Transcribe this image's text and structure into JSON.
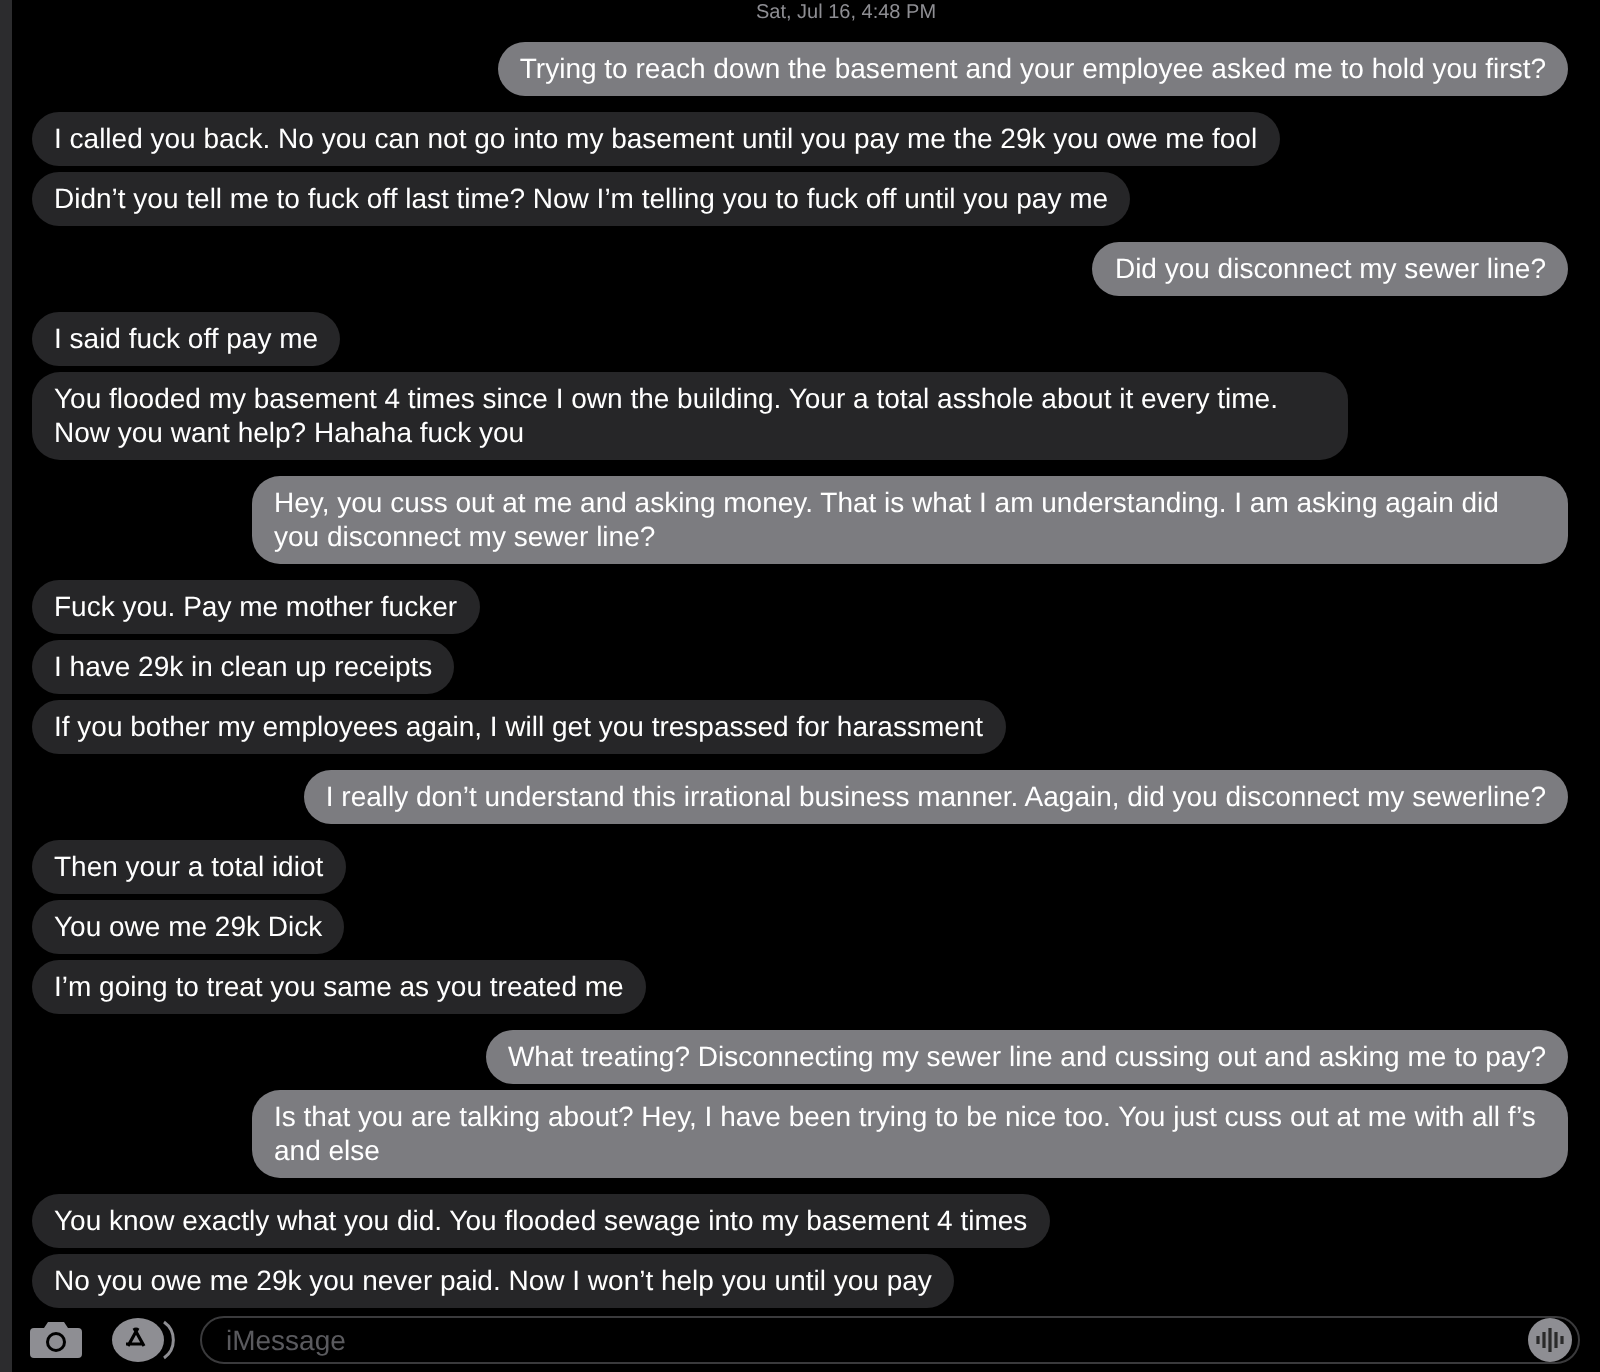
{
  "timestamp": "Sat, Jul 16, 4:48 PM",
  "messages": [
    {
      "kind": "sent",
      "text": "Trying to reach down the basement and your employee asked me to hold you first?"
    },
    {
      "kind": "received",
      "text": "I called you back. No you can not go into my basement until you pay me the 29k you owe me fool"
    },
    {
      "kind": "received",
      "text": "Didn’t you tell me to fuck off last time? Now I’m telling you to fuck off until you pay me"
    },
    {
      "kind": "sent",
      "text": "Did you disconnect my sewer line?"
    },
    {
      "kind": "received",
      "text": "I said fuck off pay me"
    },
    {
      "kind": "received",
      "text": "You flooded my basement 4 times since I own the building. Your a total asshole about it every time. Now you want help? Hahaha fuck you"
    },
    {
      "kind": "sent",
      "text": "Hey, you cuss out at me and asking money. That is what I am understanding. I am asking again did you disconnect my sewer line?"
    },
    {
      "kind": "received",
      "text": "Fuck you. Pay me mother fucker"
    },
    {
      "kind": "received",
      "text": "I have 29k in clean up receipts"
    },
    {
      "kind": "received",
      "text": "If you bother my employees again, I will get you trespassed for harassment"
    },
    {
      "kind": "sent",
      "text": "I really don’t understand this irrational business manner. Aagain, did you disconnect my sewerline?"
    },
    {
      "kind": "received",
      "text": "Then your a total idiot"
    },
    {
      "kind": "received",
      "text": "You owe me 29k Dick"
    },
    {
      "kind": "received",
      "text": "I’m going to treat you same as you treated me"
    },
    {
      "kind": "sent",
      "text": "What treating? Disconnecting my sewer line and cussing out and asking me to pay?"
    },
    {
      "kind": "sent",
      "text": "Is that you are talking about? Hey, I have been trying to be nice too. You just cuss out at me  with all f’s and else"
    },
    {
      "kind": "received",
      "text": "You know exactly what you did. You flooded sewage into my basement 4 times"
    },
    {
      "kind": "received",
      "text": "No you owe me 29k you never paid. Now I won’t help you until you pay"
    }
  ],
  "compose": {
    "placeholder": "iMessage"
  }
}
